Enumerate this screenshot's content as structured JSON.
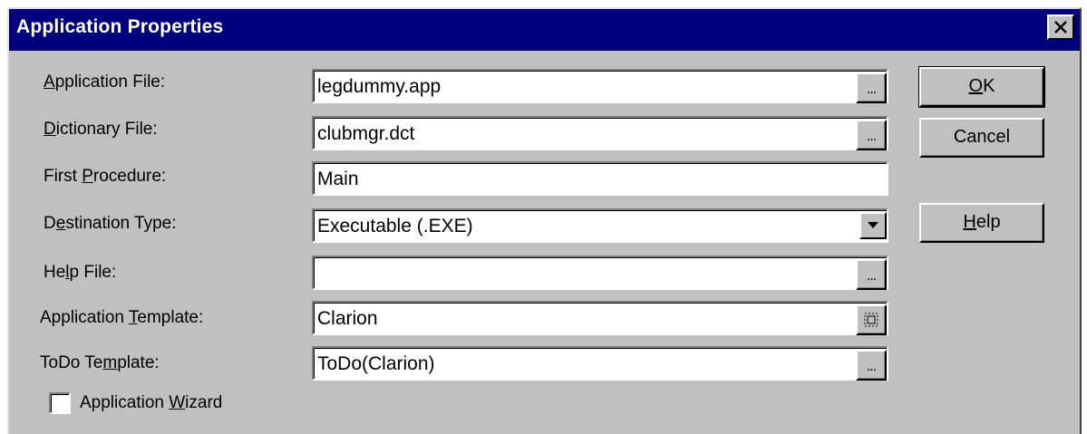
{
  "window": {
    "title": "Application Properties"
  },
  "fields": [
    {
      "pre": "",
      "key": "A",
      "post": "pplication File:",
      "value": "legdummy.app"
    },
    {
      "pre": "",
      "key": "D",
      "post": "ictionary File:",
      "value": "clubmgr.dct"
    },
    {
      "pre": "First ",
      "key": "P",
      "post": "rocedure:",
      "value": "Main"
    },
    {
      "pre": "D",
      "key": "e",
      "post": "stination Type:",
      "value": "Executable (.EXE)"
    },
    {
      "pre": "He",
      "key": "l",
      "post": "p File:",
      "value": ""
    },
    {
      "pre": "Application ",
      "key": "T",
      "post": "emplate:",
      "value": "Clarion"
    },
    {
      "pre": "ToDo Te",
      "key": "m",
      "post": "plate:",
      "value": "ToDo(Clarion)"
    }
  ],
  "browse_label": "...",
  "buttons": {
    "ok": {
      "key": "O",
      "rest": "K"
    },
    "cancel": {
      "label": "Cancel"
    },
    "help": {
      "key": "H",
      "rest": "elp"
    }
  },
  "wizard": {
    "pre": "Application ",
    "key": "W",
    "post": "izard",
    "checked": false
  },
  "icons": {
    "close": "close-icon",
    "dropdown": "chevron-down-icon",
    "template": "template-icon"
  },
  "colors": {
    "titlebar": "#00007f",
    "face": "#c0c0c0"
  }
}
